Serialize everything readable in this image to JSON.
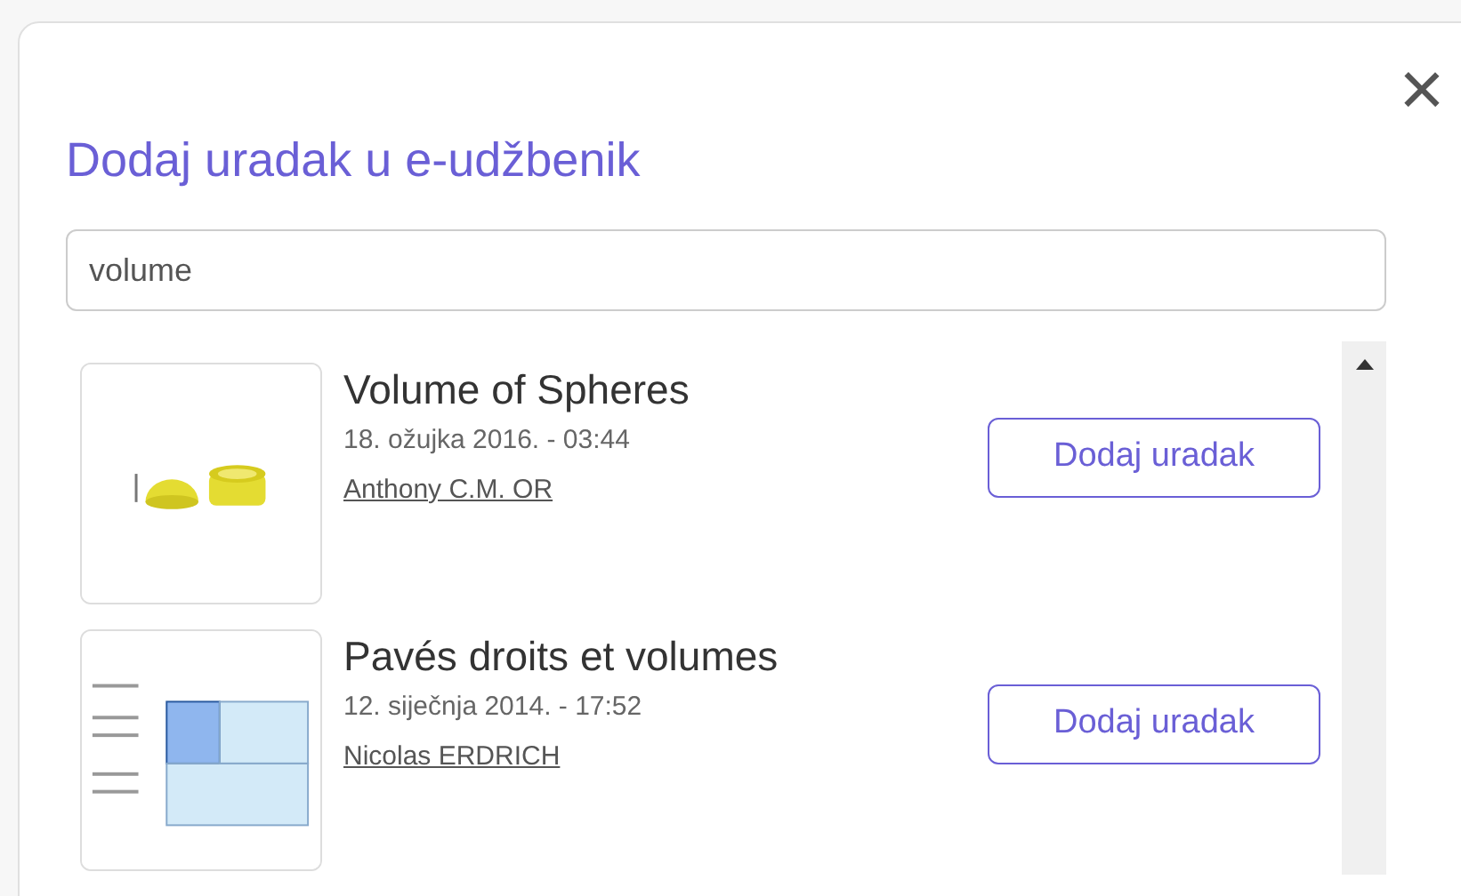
{
  "dialog": {
    "title": "Dodaj uradak u e-udžbenik",
    "close": "×",
    "search": {
      "value": "volume"
    },
    "results": [
      {
        "title": "Volume of Spheres",
        "date": "18. ožujka 2016. - 03:44",
        "author": "Anthony C.M. OR",
        "button": "Dodaj uradak"
      },
      {
        "title": "Pavés droits et volumes",
        "date": "12. siječnja 2014. - 17:52",
        "author": "Nicolas ERDRICH",
        "button": "Dodaj uradak"
      }
    ]
  }
}
